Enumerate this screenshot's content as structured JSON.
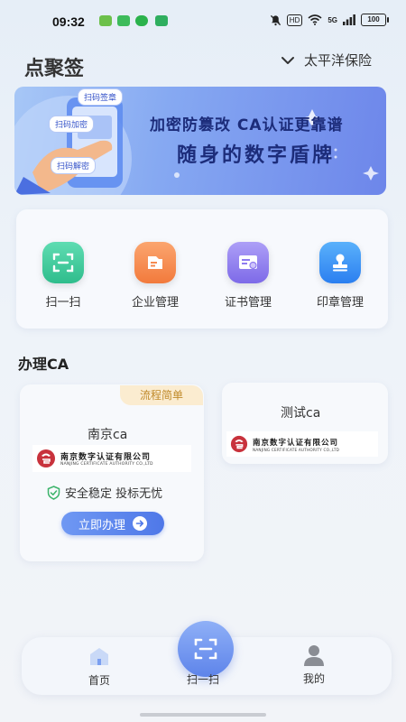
{
  "status_bar": {
    "time": "09:32",
    "hd": "HD",
    "network": "5G",
    "battery": "100"
  },
  "header": {
    "title": "点聚签",
    "company": "太平洋保险"
  },
  "banner": {
    "line1": "加密防篡改 CA认证更靠谱",
    "line2": "随身的数字盾牌",
    "chip_sign": "扫码签章",
    "chip_encrypt": "扫码加密",
    "chip_decrypt": "扫码解密"
  },
  "features": [
    {
      "label": "扫一扫",
      "icon": "scan-icon",
      "color": "#3cc99a"
    },
    {
      "label": "企业管理",
      "icon": "folder-icon",
      "color": "#f58a4f"
    },
    {
      "label": "证书管理",
      "icon": "certificate-icon",
      "color": "#8f7cf0"
    },
    {
      "label": "印章管理",
      "icon": "seal-icon",
      "color": "#3a91f2"
    }
  ],
  "section": {
    "title": "办理CA"
  },
  "ca_main": {
    "tag": "流程简单",
    "name": "南京ca",
    "logo_cn": "南京数字认证有限公司",
    "logo_en": "NANJING CERTIFICATE AUTHORITY CO.,LTD",
    "secure_text": "安全稳定 投标无忧",
    "apply_label": "立即办理"
  },
  "ca_second": {
    "name": "测试ca",
    "logo_cn": "南京数字认证有限公司",
    "logo_en": "NANJING CERTIFICATE AUTHORITY CO.,LTD"
  },
  "bottom_nav": {
    "home": "首页",
    "scan": "扫一扫",
    "mine": "我的"
  },
  "colors": {
    "accent": "#5e84ea",
    "tag_bg": "#fbecd0",
    "tag_text": "#c08a2a",
    "secure_green": "#3bb36a",
    "logo_red": "#c8323c"
  }
}
